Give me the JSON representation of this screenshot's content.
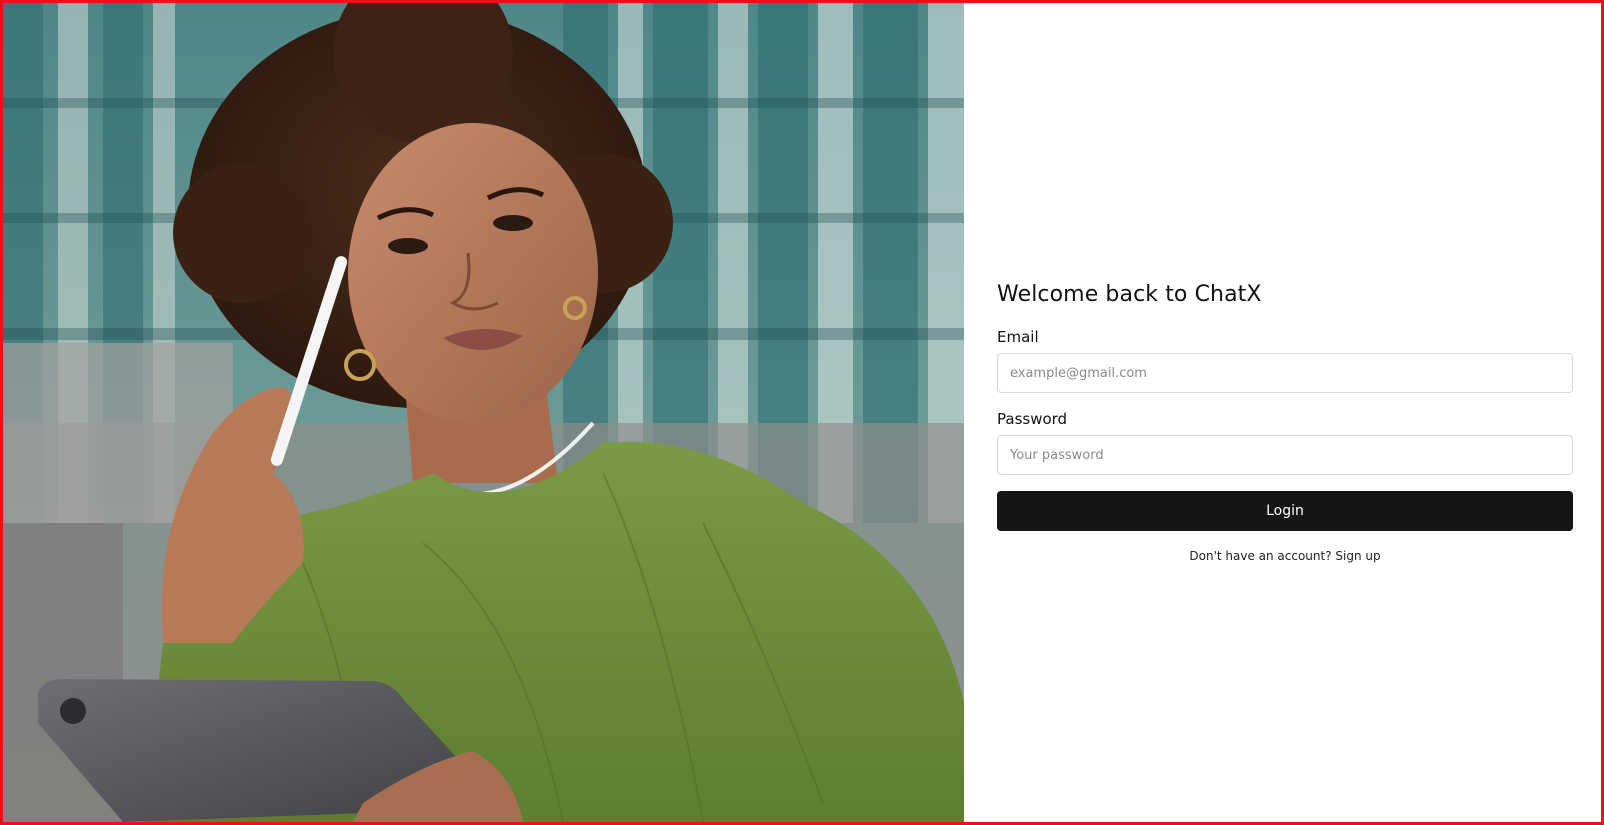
{
  "login": {
    "title": "Welcome back to ChatX",
    "email_label": "Email",
    "email_placeholder": "example@gmail.com",
    "email_value": "",
    "password_label": "Password",
    "password_placeholder": "Your password",
    "password_value": "",
    "login_button": "Login",
    "signup_prompt": "Don't have an account?",
    "signup_link": "Sign up"
  },
  "theme": {
    "frame_border": "#e4141b",
    "button_bg": "#151515",
    "button_text": "#ffffff",
    "sweater_green": "#6f8f3e"
  },
  "hero_image": {
    "icon": "woman-with-tablet-photo"
  }
}
